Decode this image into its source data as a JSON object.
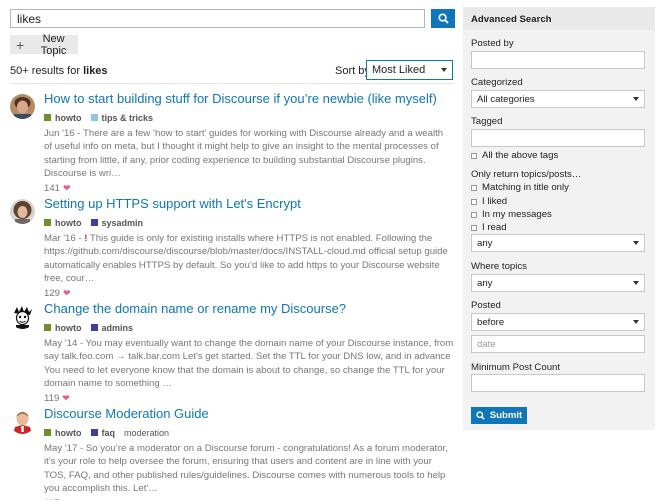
{
  "search": {
    "value": "likes"
  },
  "new_topic_label": "New Topic",
  "results_header": {
    "count": "50+ results for",
    "term": "likes",
    "sort_label": "Sort by",
    "sort_value": "Most Liked"
  },
  "results": [
    {
      "title": "How to start building stuff for Discourse if you’re newbie (like myself)",
      "tags": [
        {
          "label": "howto",
          "color": "#6f8f2c",
          "bold": true
        },
        {
          "label": "tips & tricks",
          "color": "#8fc7e6",
          "bold": true
        }
      ],
      "date": "Jun '16",
      "prefix": "",
      "blurb_lines": [
        " - There are a few ‘how to start’ guides for working with Discourse already and a wealth",
        "of useful info on meta, but I thought it might help to give an insight to the mental processes of",
        "starting from little, if any, prior coding experience to building substantial Discourse plugins.",
        "Discourse is wri…"
      ],
      "likes": "141"
    },
    {
      "title": "Setting up HTTPS support with Let's Encrypt",
      "tags": [
        {
          "label": "howto",
          "color": "#6f8f2c",
          "bold": true
        },
        {
          "label": "sysadmin",
          "color": "#3b3fa0",
          "bold": true
        }
      ],
      "date": "Mar '16",
      "prefix": "!",
      "blurb_lines": [
        " This guide is only for existing installs where HTTPS is not enabled. Following the",
        "https://github.com/discourse/discourse/blob/master/docs/INSTALL-cloud.md official setup guide",
        "automatically enables HTTPS by default. So you’d like to add https to your Discourse website",
        "free, cour…"
      ],
      "likes": "129"
    },
    {
      "title": "Change the domain name or rename my Discourse?",
      "tags": [
        {
          "label": "howto",
          "color": "#6f8f2c",
          "bold": true
        },
        {
          "label": "admins",
          "color": "#3b3fa0",
          "bold": true
        }
      ],
      "date": "May '14",
      "prefix": "",
      "blurb_lines": [
        " - You may eventually want to change the domain name of your Discourse instance, from",
        "say talk.foo.com → talk.bar.com Let's get started. Set the TTL for your DNS low, and in advance",
        "You need to let everyone know that the domain is about to change, so change the TTL for your",
        "domain name to something …"
      ],
      "likes": "119"
    },
    {
      "title": "Discourse Moderation Guide",
      "tags": [
        {
          "label": "howto",
          "color": "#6f8f2c",
          "bold": true
        },
        {
          "label": "faq",
          "color": "#3b3fa0",
          "bold": true
        },
        {
          "label": "moderation",
          "color": "",
          "bold": false
        }
      ],
      "date": "May '17",
      "prefix": "",
      "blurb_lines": [
        " - So you’re a moderator on a Discourse forum - congratulations! As a forum moderator,",
        "it's your role to help oversee the forum, ensuring that users and content are in line with your",
        "TOS, FAQ, and other published rules/guidelines. Discourse comes with numerous tools to help",
        "you accomplish this. Let'…"
      ],
      "likes": "117"
    }
  ],
  "advanced": {
    "title": "Advanced Search",
    "posted_by_label": "Posted by",
    "categorized_label": "Categorized",
    "category_value": "All categories",
    "tagged_label": "Tagged",
    "all_tags_label": "All the above tags",
    "only_return_label": "Only return topics/posts…",
    "checks": [
      "Matching in title only",
      "I liked",
      "In my messages",
      "I read"
    ],
    "only_return_value": "any",
    "where_topics_label": "Where topics",
    "where_topics_value": "any",
    "posted_label": "Posted",
    "posted_value": "before",
    "date_placeholder": "date",
    "min_post_label": "Minimum Post Count",
    "submit_label": "Submit"
  },
  "colors": {
    "accent": "#0e76b9",
    "heart": "#e45b87"
  }
}
